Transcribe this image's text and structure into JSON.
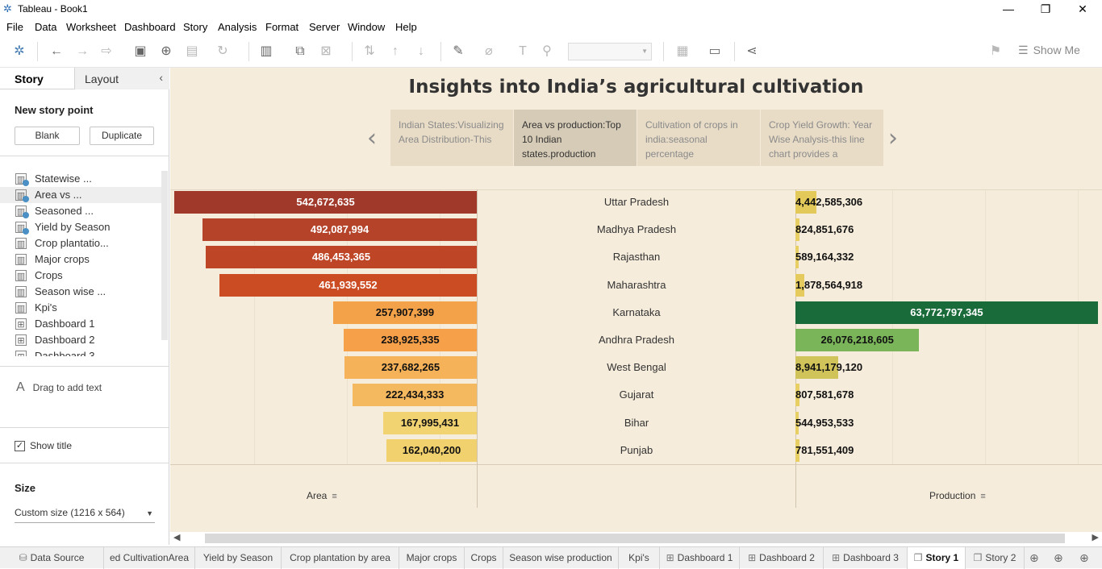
{
  "window": {
    "title": "Tableau - Book1",
    "minimize": "—",
    "restore": "❐",
    "close": "✕"
  },
  "menu": [
    "File",
    "Data",
    "Worksheet",
    "Dashboard",
    "Story",
    "Analysis",
    "Format",
    "Server",
    "Window",
    "Help"
  ],
  "toolbar": {
    "show_me_label": "Show Me"
  },
  "left_pane": {
    "tab_story": "Story",
    "tab_layout": "Layout",
    "new_story_point": "New story point",
    "blank_button": "Blank",
    "duplicate_button": "Duplicate",
    "sheets": [
      {
        "name": "Statewise ...",
        "type": "worksheet",
        "used": true
      },
      {
        "name": "Area vs ...",
        "type": "worksheet",
        "used": true
      },
      {
        "name": "Seasoned ...",
        "type": "worksheet",
        "used": true
      },
      {
        "name": "Yield by Season",
        "type": "worksheet",
        "used": true
      },
      {
        "name": "Crop plantatio...",
        "type": "worksheet",
        "used": false
      },
      {
        "name": "Major crops",
        "type": "worksheet",
        "used": false
      },
      {
        "name": "Crops",
        "type": "worksheet",
        "used": false
      },
      {
        "name": "Season wise ...",
        "type": "worksheet",
        "used": false
      },
      {
        "name": "Kpi's",
        "type": "worksheet",
        "used": false
      },
      {
        "name": "Dashboard 1",
        "type": "dashboard",
        "used": false
      },
      {
        "name": "Dashboard 2",
        "type": "dashboard",
        "used": false
      },
      {
        "name": "Dashboard 3",
        "type": "dashboard",
        "used": false
      }
    ],
    "drag_text": "Drag to add text",
    "text_icon": "A",
    "show_title_label": "Show title",
    "show_title_checked": true,
    "size_heading": "Size",
    "size_value": "Custom size (1216 x 564)"
  },
  "story": {
    "title": "Insights into India’s agricultural cultivation",
    "points": [
      {
        "text": "Indian States:Visualizing Area Distribution-This",
        "active": false
      },
      {
        "text": "Area vs production:Top 10 Indian states.production",
        "active": true
      },
      {
        "text": "Cultivation of crops in india:seasonal percentage",
        "active": false
      },
      {
        "text": "Crop Yield Growth: Year Wise Analysis-this line chart provides a",
        "active": false
      }
    ],
    "prev_arrow": "‹",
    "next_arrow": "›"
  },
  "chart_data": {
    "type": "bar",
    "categories": [
      "Uttar Pradesh",
      "Madhya Pradesh",
      "Rajasthan",
      "Maharashtra",
      "Karnataka",
      "Andhra Pradesh",
      "West Bengal",
      "Gujarat",
      "Bihar",
      "Punjab"
    ],
    "series": [
      {
        "name": "Area",
        "values": [
          542672635,
          492087994,
          486453365,
          461939552,
          257907399,
          238925335,
          237682265,
          222434333,
          167995431,
          162040200
        ],
        "labels": [
          "542,672,635",
          "492,087,994",
          "486,453,365",
          "461,939,552",
          "257,907,399",
          "238,925,335",
          "237,682,265",
          "222,434,333",
          "167,995,431",
          "162,040,200"
        ],
        "colors": [
          "#a0392a",
          "#b4432a",
          "#be4526",
          "#cb4b22",
          "#f4a24a",
          "#f7a04a",
          "#f5b259",
          "#f4b85e",
          "#f2d372",
          "#f1d06e"
        ]
      },
      {
        "name": "Production",
        "values": [
          4442585306,
          824851676,
          589164332,
          1878564918,
          63772797345,
          26076218605,
          8941179120,
          807581678,
          544953533,
          781551409
        ],
        "labels": [
          "4,442,585,306",
          "824,851,676",
          "589,164,332",
          "1,878,564,918",
          "63,772,797,345",
          "26,076,218,605",
          "8,941,179,120",
          "807,581,678",
          "544,953,533",
          "781,551,409"
        ],
        "colors": [
          "#e3c95a",
          "#e7cf63",
          "#e7cf63",
          "#e5cb5e",
          "#1a6b3a",
          "#7ab55a",
          "#cfc35a",
          "#e7cf63",
          "#e7cf63",
          "#e7cf63"
        ]
      }
    ],
    "xlabel_area": "Area",
    "xlabel_production": "Production",
    "sort_icon": "sort-descending-icon",
    "xlim_area": [
      0,
      580000000
    ],
    "xlim_production": [
      0,
      65000000000
    ]
  },
  "sheet_tabs": [
    {
      "label": "Data Source",
      "icon": "⛁",
      "active": false
    },
    {
      "label": "ed CultivationArea",
      "icon": "",
      "active": false
    },
    {
      "label": "Yield by Season",
      "icon": "",
      "active": false
    },
    {
      "label": "Crop plantation by area",
      "icon": "",
      "active": false
    },
    {
      "label": "Major crops",
      "icon": "",
      "active": false
    },
    {
      "label": "Crops",
      "icon": "",
      "active": false
    },
    {
      "label": "Season wise production",
      "icon": "",
      "active": false
    },
    {
      "label": "Kpi's",
      "icon": "",
      "active": false
    },
    {
      "label": "Dashboard 1",
      "icon": "⊞",
      "active": false
    },
    {
      "label": "Dashboard 2",
      "icon": "⊞",
      "active": false
    },
    {
      "label": "Dashboard 3",
      "icon": "⊞",
      "active": false
    },
    {
      "label": "Story 1",
      "icon": "❐",
      "active": true
    },
    {
      "label": "Story 2",
      "icon": "❐",
      "active": false
    }
  ]
}
